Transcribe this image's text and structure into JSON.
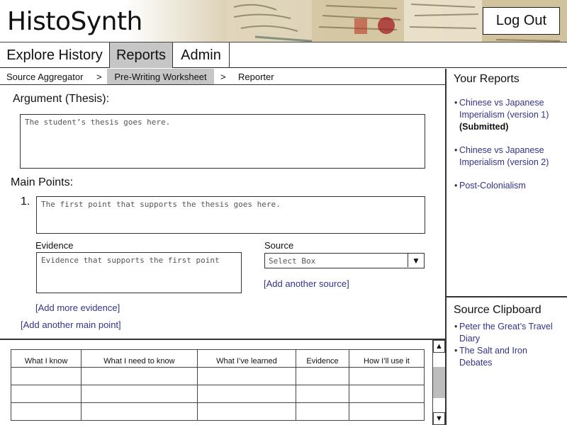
{
  "header": {
    "app_title": "HistoSynth",
    "logout_label": "Log Out"
  },
  "tabs": [
    {
      "label": "Explore History",
      "active": false
    },
    {
      "label": "Reports",
      "active": true
    },
    {
      "label": "Admin",
      "active": false
    }
  ],
  "breadcrumb": {
    "items": [
      "Source Aggregator",
      "Pre-Writing Worksheet",
      "Reporter"
    ],
    "separator": ">",
    "active_index": 1
  },
  "worksheet": {
    "thesis_label": "Argument (Thesis):",
    "thesis_placeholder": "The student’s thesis goes here.",
    "main_points_label": "Main Points:",
    "point_number": "1.",
    "point_placeholder": "The first point that supports the thesis goes here.",
    "evidence_label": "Evidence",
    "evidence_placeholder": "Evidence that supports the first point",
    "source_label": "Source",
    "source_select_value": "Select Box",
    "add_source_link": "[Add another source]",
    "add_evidence_link": "[Add more evidence]",
    "add_main_point_link": "[Add another main point]"
  },
  "kwl_table": {
    "headers": [
      "What I know",
      "What I need to know",
      "What I’ve learned",
      "Evidence",
      "How I’ll use it"
    ],
    "rows": [
      [
        "",
        "",
        "",
        "",
        ""
      ],
      [
        "",
        "",
        "",
        "",
        ""
      ],
      [
        "",
        "",
        "",
        "",
        ""
      ]
    ]
  },
  "sidebar": {
    "reports_title": "Your Reports",
    "reports": [
      {
        "title": "Chinese vs Japanese Imperialism (version 1)",
        "status": "(Submitted)"
      },
      {
        "title": "Chinese vs Japanese Imperialism (version 2)",
        "status": ""
      },
      {
        "title": "Post-Colonialism",
        "status": ""
      }
    ],
    "clipboard_title": "Source Clipboard",
    "clipboard": [
      {
        "title": "Peter the Great’s Travel Diary"
      },
      {
        "title": "The Salt and Iron Debates"
      }
    ]
  },
  "colors": {
    "link": "#33338a",
    "active_tab": "#c6c6c6",
    "scroll_track": "#bdbdbd"
  },
  "icons": {
    "select_arrow": "triangle-down-icon",
    "scroll_up": "triangle-up-icon",
    "scroll_down": "triangle-down-icon"
  }
}
